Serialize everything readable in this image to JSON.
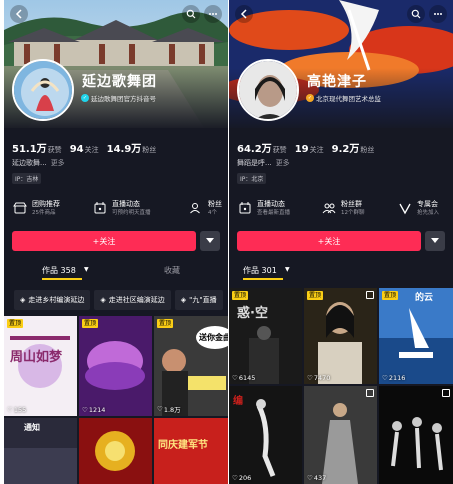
{
  "profiles": [
    {
      "name": "延边歌舞团",
      "verified_text": "延边歌舞团官方抖音号",
      "stats": [
        {
          "num": "51.1万",
          "label": "获赞"
        },
        {
          "num": "94",
          "label": "关注"
        },
        {
          "num": "14.9万",
          "label": "粉丝"
        }
      ],
      "bio": "延边歌舞...",
      "bio_more": "更多",
      "location": "IP：吉林",
      "services": [
        {
          "title": "团购推荐",
          "sub": "25件商品",
          "icon": "shop-icon"
        },
        {
          "title": "直播动态",
          "sub": "可预约明天直播",
          "icon": "calendar-icon"
        },
        {
          "title": "粉丝",
          "sub": "4个",
          "icon": "fans-icon"
        }
      ],
      "follow_label": "+关注",
      "tab_works": "作品 358",
      "tab_fav": "收藏",
      "playlists": [
        "走进乡村编演延边",
        "走进社区编演延边",
        "\"九\"直播"
      ],
      "tiles": [
        {
          "likes": "155",
          "pinned": true,
          "text": "周山如梦"
        },
        {
          "likes": "1214",
          "pinned": true,
          "text": ""
        },
        {
          "likes": "1.8万",
          "pinned": true,
          "text": "送你金曲"
        },
        {
          "likes": "",
          "pinned": false,
          "text": "通知"
        },
        {
          "likes": "",
          "pinned": false,
          "text": ""
        },
        {
          "likes": "",
          "pinned": false,
          "text": "同庆建军节"
        }
      ]
    },
    {
      "name": "高艳津子",
      "verified_text": "北京现代舞团艺术总监",
      "stats": [
        {
          "num": "64.2万",
          "label": "获赞"
        },
        {
          "num": "19",
          "label": "关注"
        },
        {
          "num": "9.2万",
          "label": "粉丝"
        }
      ],
      "bio": "舞蹈是呼...",
      "bio_more": "更多",
      "location": "IP：北京",
      "services": [
        {
          "title": "直播动态",
          "sub": "查看最新直播",
          "icon": "calendar-icon"
        },
        {
          "title": "粉丝群",
          "sub": "12个群聊",
          "icon": "group-icon"
        },
        {
          "title": "专属会",
          "sub": "抢先加入",
          "icon": "vip-icon"
        }
      ],
      "follow_label": "+关注",
      "tab_works": "作品 301",
      "tiles": [
        {
          "likes": "6145",
          "pinned": true,
          "text": "惑·空"
        },
        {
          "likes": "7470",
          "pinned": true,
          "text": ""
        },
        {
          "likes": "2116",
          "pinned": true,
          "text": "的云"
        },
        {
          "likes": "206",
          "pinned": false,
          "text": "编"
        },
        {
          "likes": "437",
          "pinned": false,
          "text": ""
        },
        {
          "likes": "",
          "pinned": false,
          "text": ""
        }
      ]
    }
  ],
  "pinned_label": "置顶",
  "colors": {
    "accent": "#fe2c55",
    "pin": "#face15",
    "bg": "#161823"
  }
}
